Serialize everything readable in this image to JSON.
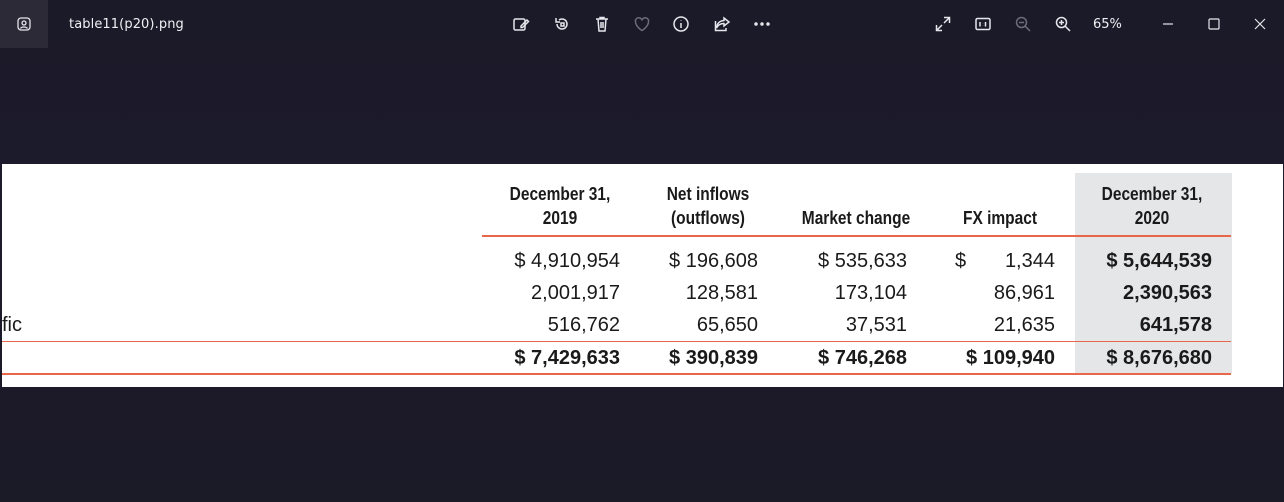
{
  "window": {
    "filename": "table11(p20).png",
    "zoom": "65%"
  },
  "toolbar": {
    "icons": [
      "edit-image-icon",
      "rotate-icon",
      "delete-icon",
      "favorite-icon",
      "info-icon",
      "share-icon",
      "more-icon"
    ],
    "right_icons": [
      "fullscreen-icon",
      "actual-size-icon",
      "zoom-out-icon",
      "zoom-in-icon"
    ]
  },
  "table": {
    "headers": [
      {
        "line1": "December 31,",
        "line2": "2019"
      },
      {
        "line1": "Net inflows",
        "line2": "(outflows)"
      },
      {
        "line1": "",
        "line2": "Market change"
      },
      {
        "line1": "",
        "line2": "FX impact"
      },
      {
        "line1": "December 31,",
        "line2": "2020"
      }
    ],
    "rows": [
      {
        "label": "",
        "cells": [
          "$ 4,910,954",
          "$ 196,608",
          "$ 535,633",
          "$",
          "1,344",
          "$ 5,644,539"
        ]
      },
      {
        "label": "",
        "cells": [
          "2,001,917",
          "128,581",
          "173,104",
          "86,961",
          "2,390,563"
        ]
      },
      {
        "label": "fic",
        "cells": [
          "516,762",
          "65,650",
          "37,531",
          "21,635",
          "641,578"
        ]
      }
    ],
    "total": [
      "$ 7,429,633",
      "$ 390,839",
      "$ 746,268",
      "$ 109,940",
      "$ 8,676,680"
    ]
  },
  "colors": {
    "accent_rule": "#e8674a",
    "highlight_column": "#e5e6e8",
    "background": "#1c1b2a"
  }
}
